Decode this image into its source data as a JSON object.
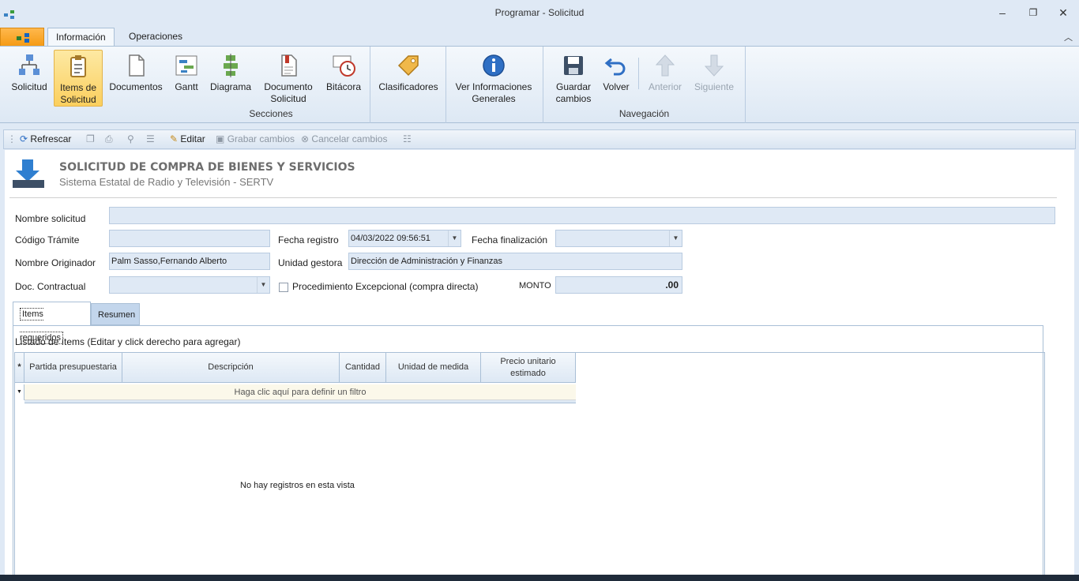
{
  "window": {
    "title": "Programar - Solicitud"
  },
  "tabs": {
    "informacion": "Información",
    "operaciones": "Operaciones"
  },
  "ribbon": {
    "solicitud": "Solicitud",
    "items_line1": "Items de",
    "items_line2": "Solicitud",
    "documentos": "Documentos",
    "gantt": "Gantt",
    "diagrama": "Diagrama",
    "doc_line1": "Documento",
    "doc_line2": "Solicitud",
    "bitacora": "Bitácora",
    "clasificadores": "Clasificadores",
    "ver_line1": "Ver Informaciones",
    "ver_line2": "Generales",
    "guardar_line1": "Guardar",
    "guardar_line2": "cambios",
    "volver": "Volver",
    "anterior": "Anterior",
    "siguiente": "Siguiente",
    "group_secciones": "Secciones",
    "group_navegacion": "Navegación"
  },
  "toolbar": {
    "refrescar": "Refrescar",
    "editar": "Editar",
    "grabar": "Grabar cambios",
    "cancelar": "Cancelar cambios"
  },
  "header": {
    "title": "SOLICITUD DE COMPRA DE BIENES Y SERVICIOS",
    "subtitle": "Sistema Estatal de Radio y Televisión - SERTV"
  },
  "form": {
    "nombre_solicitud_label": "Nombre solicitud",
    "nombre_solicitud_value": "",
    "codigo_tramite_label": "Código Trámite",
    "codigo_tramite_value": "",
    "fecha_registro_label": "Fecha registro",
    "fecha_registro_value": "04/03/2022 09:56:51",
    "fecha_finalizacion_label": "Fecha finalización",
    "fecha_finalizacion_value": "",
    "nombre_originador_label": "Nombre Originador",
    "nombre_originador_value": "Palm Sasso,Fernando Alberto",
    "unidad_gestora_label": "Unidad gestora",
    "unidad_gestora_value": "Dirección de Administración y Finanzas",
    "doc_contractual_label": "Doc. Contractual",
    "doc_contractual_value": "",
    "procedimiento_label": "Procedimiento Excepcional (compra directa)",
    "procedimiento_checked": false,
    "monto_label": "MONTO",
    "monto_value": ".00"
  },
  "panel_tabs": {
    "items": "Items requeridos",
    "resumen": "Resumen"
  },
  "grid": {
    "caption": "Listado de ítems (Editar y click derecho para agregar)",
    "new_row_marker": "*",
    "filter_marker": "▼",
    "columns": [
      "Partida presupuestaria",
      "Descripción",
      "Cantidad",
      "Unidad de medida",
      "Precio unitario estimado"
    ],
    "filter_hint": "Haga clic aquí para definir un filtro",
    "empty_text": "No hay registros en esta vista"
  },
  "colors": {
    "accent": "#dfe9f5",
    "app_button": "#f59b15",
    "selected": "#fbcf5e"
  }
}
